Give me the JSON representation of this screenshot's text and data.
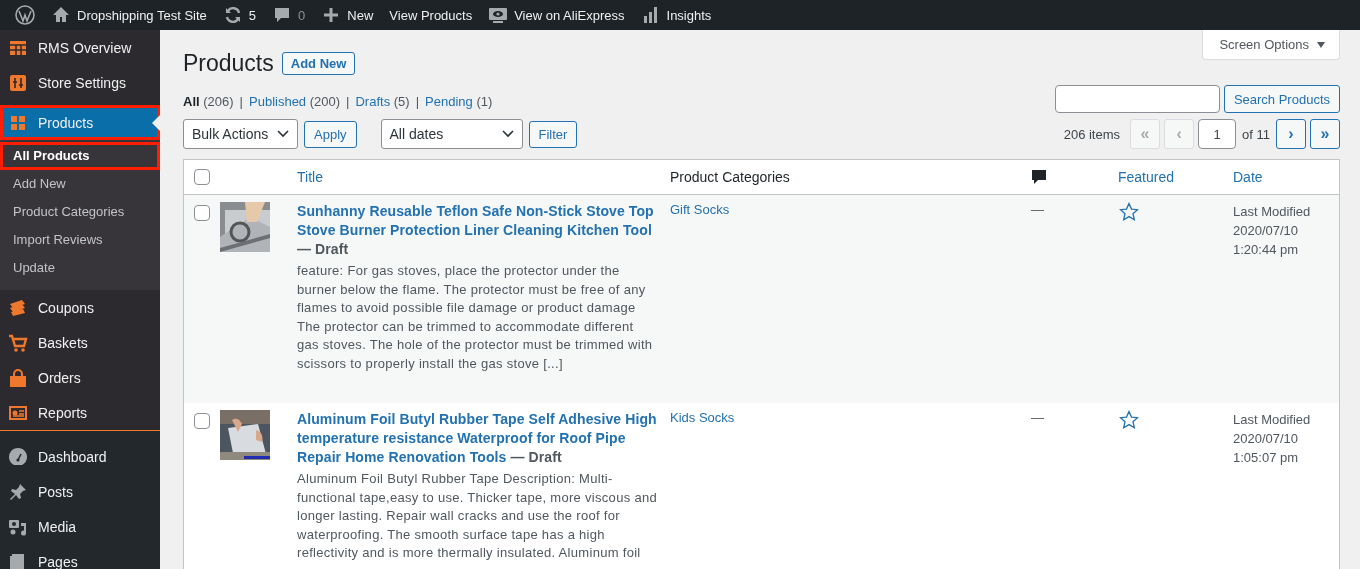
{
  "admin_bar": {
    "items": [
      {
        "kind": "logo"
      },
      {
        "kind": "site",
        "label": "Dropshipping Test Site"
      },
      {
        "kind": "updates",
        "label": "5"
      },
      {
        "kind": "comments",
        "label": "0"
      },
      {
        "kind": "new",
        "label": "New"
      },
      {
        "kind": "link",
        "label": "View Products"
      },
      {
        "kind": "aliexpress",
        "label": "View on AliExpress"
      },
      {
        "kind": "insights",
        "label": "Insights"
      }
    ]
  },
  "sidebar": {
    "items": [
      {
        "label": "RMS Overview",
        "kind": "store",
        "selected": false,
        "highlighted": false
      },
      {
        "label": "Store Settings",
        "kind": "store",
        "selected": false,
        "highlighted": false
      },
      {
        "label": "Products",
        "kind": "store",
        "selected": true,
        "highlighted": true,
        "children": [
          {
            "label": "All Products",
            "selected": true,
            "highlighted": true
          },
          {
            "label": "Add New",
            "selected": false,
            "highlighted": false
          },
          {
            "label": "Product Categories",
            "selected": false,
            "highlighted": false
          },
          {
            "label": "Import Reviews",
            "selected": false,
            "highlighted": false
          },
          {
            "label": "Update",
            "selected": false,
            "highlighted": false
          }
        ]
      },
      {
        "label": "Coupons",
        "kind": "store",
        "selected": false,
        "highlighted": false
      },
      {
        "label": "Baskets",
        "kind": "store",
        "selected": false,
        "highlighted": false
      },
      {
        "label": "Orders",
        "kind": "store",
        "selected": false,
        "highlighted": false
      },
      {
        "label": "Reports",
        "kind": "store",
        "selected": false,
        "highlighted": false
      },
      {
        "label": "Dashboard",
        "kind": "wp",
        "selected": false,
        "highlighted": false
      },
      {
        "label": "Posts",
        "kind": "wp",
        "selected": false,
        "highlighted": false
      },
      {
        "label": "Media",
        "kind": "wp",
        "selected": false,
        "highlighted": false
      },
      {
        "label": "Pages",
        "kind": "wp",
        "selected": false,
        "highlighted": false
      }
    ]
  },
  "screen_options": {
    "label": "Screen Options"
  },
  "heading": {
    "title": "Products",
    "add_new": "Add New"
  },
  "views": [
    {
      "label": "All",
      "count": "(206)",
      "selected": true
    },
    {
      "label": "Published",
      "count": "(200)",
      "selected": false
    },
    {
      "label": "Drafts",
      "count": "(5)",
      "selected": false
    },
    {
      "label": "Pending",
      "count": "(1)",
      "selected": false
    }
  ],
  "view_separator": "|",
  "search": {
    "button": "Search Products"
  },
  "bulk_actions": {
    "value": "Bulk Actions",
    "apply": "Apply"
  },
  "date_filter": {
    "value": "All dates",
    "filter": "Filter"
  },
  "pagination": {
    "items": "206 items",
    "first": {
      "label": "«",
      "disabled": true
    },
    "prev": {
      "label": "‹",
      "disabled": true
    },
    "page": "1",
    "of": "of 11",
    "next": {
      "label": "›",
      "disabled": false
    },
    "last": {
      "label": "»",
      "disabled": false
    }
  },
  "table": {
    "columns": [
      {
        "label": "Title",
        "sortable": true
      },
      {
        "label": "Product Categories",
        "sortable": false
      },
      {
        "label": "Featured",
        "sortable": true
      },
      {
        "label": "Date",
        "sortable": true
      }
    ],
    "select_all": {
      "checked": false
    },
    "rows": [
      {
        "checked": false,
        "thumbnail": {
          "kind": "picture"
        },
        "title": "Sunhanny Reusable Teflon Safe Non-Stick Stove Top Stove Burner Protection Liner Cleaning Kitchen Tool",
        "status": "— Draft",
        "description": "feature: For gas stoves, place the protector under the burner below the flame. The protector must be free of any flames to avoid possible file damage or product damage The protector can be trimmed to accommodate different gas stoves. The hole of the protector must be trimmed with scissors to properly install the gas stove [...]",
        "category": "Gift Socks",
        "comments": "—",
        "featured": false,
        "date": [
          "Last Modified",
          "2020/07/10",
          "1:20:44 pm"
        ]
      },
      {
        "checked": false,
        "thumbnail": {
          "kind": "picture"
        },
        "title": "Aluminum Foil Butyl Rubber Tape Self Adhesive High temperature resistance Waterproof for Roof Pipe Repair Home Renovation Tools",
        "status": "— Draft",
        "description": "Aluminum Foil Butyl Rubber Tape   Description:   Multi-functional tape,easy to use. Thicker tape, more viscous and longer lasting. Repair wall cracks and use the roof for waterproofing. The smooth surface tape has a high reflectivity and is more thermally insulated. Aluminum foil",
        "category": "Kids Socks",
        "comments": "—",
        "featured": false,
        "date": [
          "Last Modified",
          "2020/07/10",
          "1:05:07 pm"
        ]
      }
    ]
  }
}
